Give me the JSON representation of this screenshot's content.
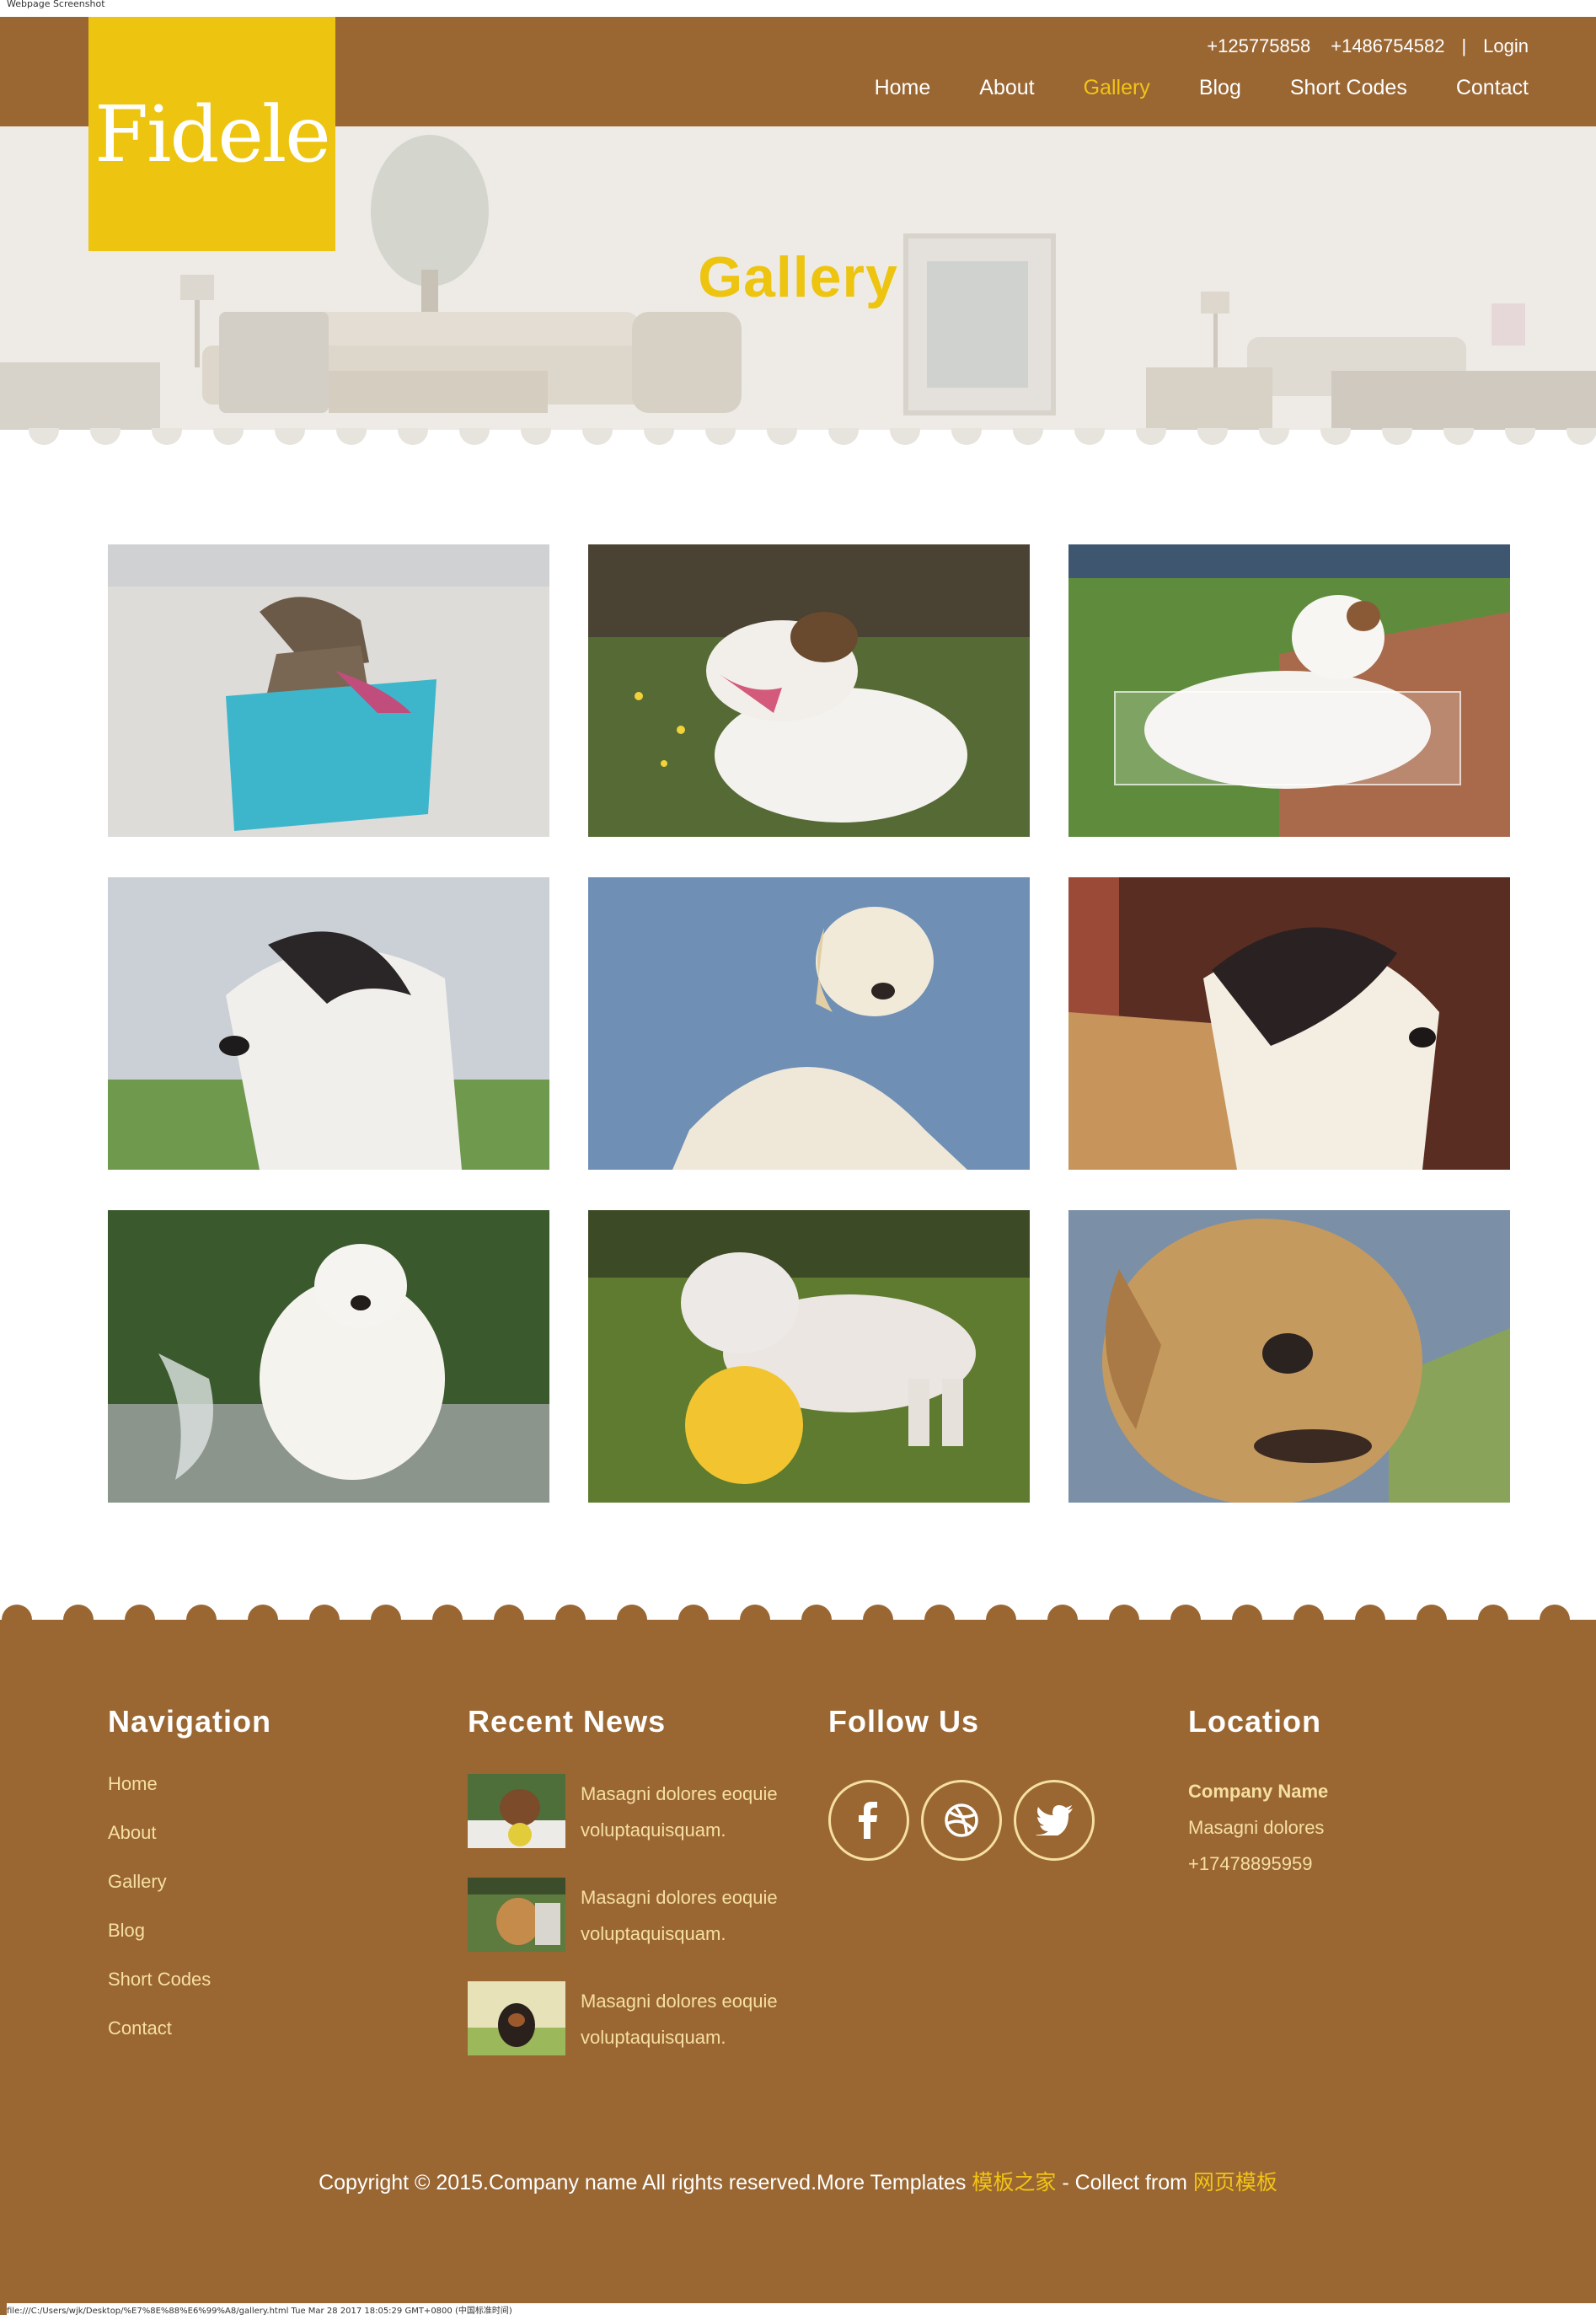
{
  "capture_label": "Webpage Screenshot",
  "brand": {
    "logo_text": "Fidele"
  },
  "colors": {
    "header_brown": "#9a6733",
    "logo_yellow": "#edc40f",
    "accent": "#f2c415",
    "footer_link": "#f6dfa2"
  },
  "contact": {
    "phone1": "+125775858",
    "phone2": "+1486754582",
    "separator": "|",
    "login": "Login"
  },
  "nav": [
    {
      "label": "Home",
      "active": false
    },
    {
      "label": "About",
      "active": false
    },
    {
      "label": "Gallery",
      "active": true
    },
    {
      "label": "Blog",
      "active": false
    },
    {
      "label": "Short Codes",
      "active": false
    },
    {
      "label": "Contact",
      "active": false
    }
  ],
  "hero": {
    "title": "Gallery"
  },
  "gallery": {
    "items": [
      {
        "subject": "greyhound-in-blue-coat"
      },
      {
        "subject": "terrier-lying-in-grass"
      },
      {
        "subject": "white-terrier-on-lawn"
      },
      {
        "subject": "border-collie-portrait"
      },
      {
        "subject": "golden-retriever-sky"
      },
      {
        "subject": "spaniel-on-wicker-chair"
      },
      {
        "subject": "retriever-splashing-water"
      },
      {
        "subject": "bulldog-with-yellow-ball"
      },
      {
        "subject": "labrador-portrait"
      }
    ]
  },
  "footer": {
    "navigation": {
      "title": "Navigation",
      "links": [
        "Home",
        "About",
        "Gallery",
        "Blog",
        "Short Codes",
        "Contact"
      ]
    },
    "news": {
      "title": "Recent News",
      "items": [
        {
          "text": "Masagni dolores eoquie voluptaquisquam."
        },
        {
          "text": "Masagni dolores eoquie voluptaquisquam."
        },
        {
          "text": "Masagni dolores eoquie voluptaquisquam."
        }
      ]
    },
    "follow": {
      "title": "Follow Us",
      "icons": [
        "facebook-icon",
        "dribbble-icon",
        "twitter-icon"
      ]
    },
    "location": {
      "title": "Location",
      "company": "Company Name",
      "address": "Masagni dolores",
      "phone": "+17478895959"
    },
    "copyright": {
      "text": "Copyright © 2015.Company name All rights reserved.More Templates ",
      "link1": "模板之家",
      "middle": " - Collect from ",
      "link2": "网页模板"
    }
  },
  "status_line": "file:///C:/Users/wjk/Desktop/%E7%8E%88%E6%99%A8/gallery.html Tue Mar 28 2017 18:05:29 GMT+0800 (中国标准时间)"
}
